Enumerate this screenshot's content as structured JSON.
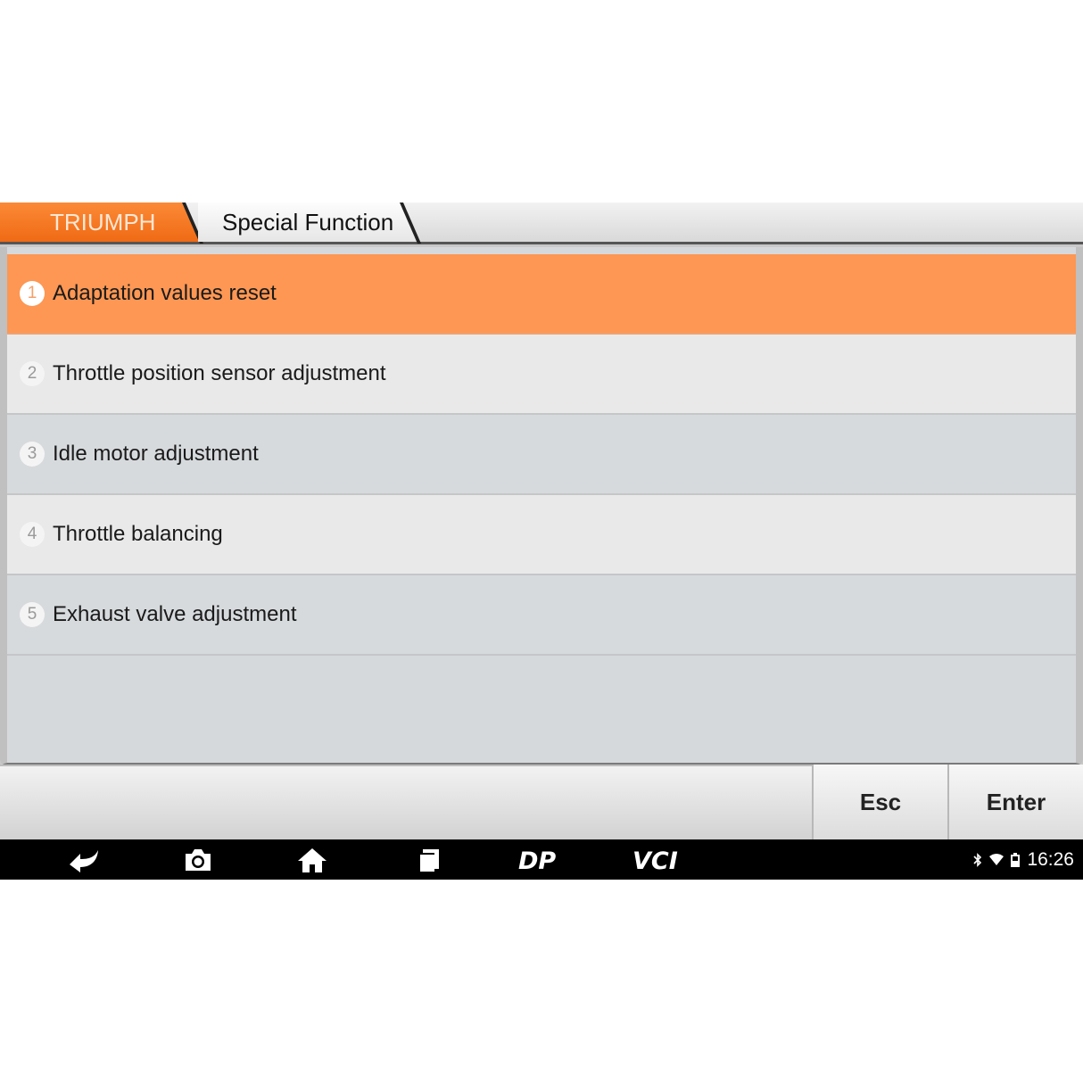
{
  "breadcrumb": {
    "brand": "TRIUMPH",
    "section": "Special Function"
  },
  "menu": {
    "items": [
      {
        "number": "1",
        "label": "Adaptation values reset",
        "selected": true
      },
      {
        "number": "2",
        "label": "Throttle position sensor adjustment",
        "selected": false
      },
      {
        "number": "3",
        "label": "Idle motor adjustment",
        "selected": false
      },
      {
        "number": "4",
        "label": "Throttle balancing",
        "selected": false
      },
      {
        "number": "5",
        "label": "Exhaust valve adjustment",
        "selected": false
      }
    ]
  },
  "actions": {
    "esc_label": "Esc",
    "enter_label": "Enter"
  },
  "navbar": {
    "icons": [
      "back-icon",
      "camera-icon",
      "home-icon",
      "recent-apps-icon",
      "dp-icon",
      "vci-icon"
    ],
    "dp_label": "DP",
    "vci_label": "VCI"
  },
  "status_bar": {
    "time": "16:26",
    "icons": [
      "bluetooth-icon",
      "wifi-icon",
      "battery-icon"
    ]
  },
  "colors": {
    "accent": "#f57a22",
    "selected_row": "#fd9753",
    "navbar": "#000000"
  }
}
